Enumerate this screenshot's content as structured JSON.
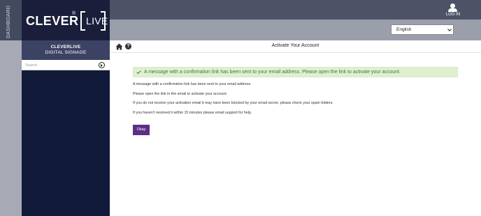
{
  "sidebar": {
    "dashboard_tab": "DASHBOARD",
    "logo": {
      "word": "CLEVER",
      "reg": "®",
      "live": "LIVE"
    },
    "brand_line1": "CLEVERLIVE",
    "brand_line2": "DIGITAL SIGNAGE",
    "search": {
      "placeholder": "Search",
      "value": ""
    }
  },
  "header": {
    "login_label": "LOG IN",
    "language": "English"
  },
  "page": {
    "title": "Activate Your Account",
    "alert": "A message with a confirmation link has been sent to your email address. Please open the link to activate your account.",
    "lines": [
      "A message with a confirmation link has been sent to your email address.",
      "Please open the link in the email to activate your account.",
      "If you do not receive your activation email it may have been blocked by your email server, please check your spam folders.",
      "If you haven't received it within 15 minutes please email support for help."
    ],
    "okay_label": "Okay"
  },
  "colors": {
    "navy": "#121a3a",
    "header": "#4d5267",
    "alert_bg": "#dff0d1",
    "alert_text": "#3c763d",
    "button": "#5c2f86"
  },
  "icons": [
    "user-icon",
    "home-icon",
    "help-icon",
    "check-icon",
    "search-go-icon",
    "chevron-down-icon"
  ]
}
